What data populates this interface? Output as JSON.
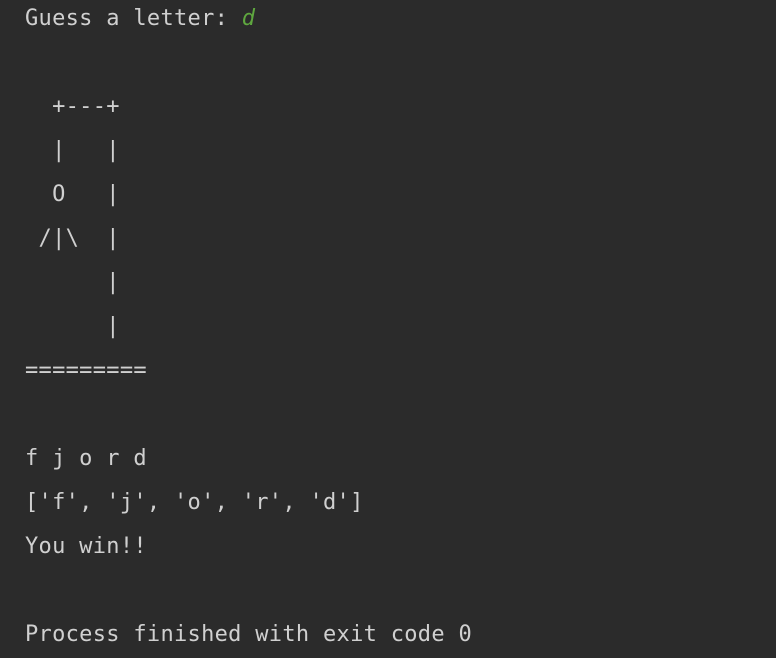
{
  "console": {
    "prompt": "Guess a letter: ",
    "user_input": "d",
    "hangman_art": [
      "  +---+",
      "  |   |",
      "  O   |",
      " /|\\  |",
      "      |",
      "      |",
      "========="
    ],
    "word_display": "f j o r d",
    "letters_list": "['f', 'j', 'o', 'r', 'd']",
    "result": "You win!!",
    "exit_message": "Process finished with exit code 0"
  },
  "colors": {
    "background": "#2b2b2b",
    "text": "#d0d0d0",
    "user_input": "#5fa83f"
  }
}
